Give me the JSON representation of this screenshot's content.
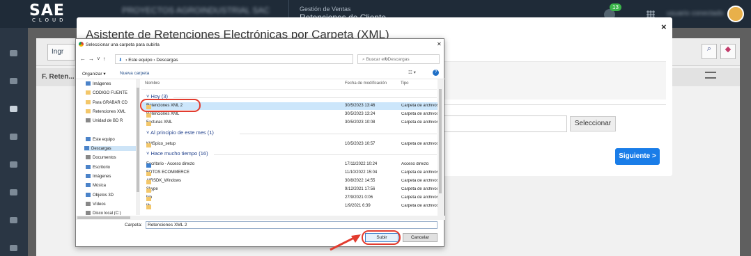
{
  "topbar": {
    "logo": "SAE",
    "logo_sub": "CLOUD",
    "company_blurred": "PROYECTOS AGROINDUSTRIAL SAC",
    "module_caption": "Gestión de Ventas",
    "module_title": "Retenciones de Cliente",
    "notifications": "13",
    "user_blurred": "usuario conectado"
  },
  "background": {
    "button_label": "Ingr",
    "section_title": "F. Reten..."
  },
  "modal": {
    "title": "Asistente de Retenciones Electrónicas por Carpeta (XML)",
    "close": "×",
    "select_button": "Seleccionar",
    "next_button": "Siguiente >"
  },
  "dialog": {
    "title": "Seleccionar una carpeta para subirla",
    "close": "✕",
    "address": [
      "Este equipo",
      "Descargas"
    ],
    "search_placeholder": "Buscar en Descargas",
    "organize": "Organizar ▾",
    "new_folder": "Nueva carpeta",
    "left_tree": [
      {
        "label": "Imágenes",
        "icon": "images-icon",
        "selected": false
      },
      {
        "label": "CODIGO FUENTE",
        "icon": "folder-icon",
        "selected": false
      },
      {
        "label": "Para GRABAR CD",
        "icon": "folder-icon",
        "selected": false
      },
      {
        "label": "Retenciones XML",
        "icon": "folder-icon",
        "selected": false
      },
      {
        "label": "Unidad de BD R",
        "icon": "drive-icon",
        "selected": false
      },
      {
        "label": "",
        "icon": "",
        "selected": false
      },
      {
        "label": "Este equipo",
        "icon": "computer-icon",
        "selected": false
      },
      {
        "label": "Descargas",
        "icon": "downloads-icon",
        "selected": true
      },
      {
        "label": "Documentos",
        "icon": "documents-icon",
        "selected": false
      },
      {
        "label": "Escritorio",
        "icon": "desktop-icon",
        "selected": false
      },
      {
        "label": "Imágenes",
        "icon": "images-icon",
        "selected": false
      },
      {
        "label": "Música",
        "icon": "music-icon",
        "selected": false
      },
      {
        "label": "Objetos 3D",
        "icon": "cube-icon",
        "selected": false
      },
      {
        "label": "Vídeos",
        "icon": "video-icon",
        "selected": false
      },
      {
        "label": "Disco local (C:)",
        "icon": "drive-icon",
        "selected": false
      }
    ],
    "columns": [
      "Nombre",
      "Fecha de modificación",
      "Tipo"
    ],
    "groups": [
      {
        "label": "Hoy (3)"
      },
      {
        "label": "Al principio de este mes (1)"
      },
      {
        "label": "Hace mucho tiempo (16)"
      }
    ],
    "rows": [
      {
        "name": "Retenciones XML 2",
        "date": "30/5/2023 13:46",
        "type": "Carpeta de archivos",
        "selected": true,
        "icon": "folder-icon"
      },
      {
        "name": "Retenciones XML",
        "date": "30/5/2023 13:24",
        "type": "Carpeta de archivos",
        "selected": false,
        "icon": "folder-icon"
      },
      {
        "name": "Facturas XML",
        "date": "30/5/2023 10:08",
        "type": "Carpeta de archivos",
        "selected": false,
        "icon": "folder-icon"
      },
      {
        "name": "KMSpico_setup",
        "date": "10/5/2023 10:57",
        "type": "Carpeta de archivos",
        "selected": false,
        "icon": "folder-icon"
      },
      {
        "name": "Escritorio - Acceso directo",
        "date": "17/11/2022 10:24",
        "type": "Acceso directo",
        "selected": false,
        "icon": "shortcut-icon"
      },
      {
        "name": "FOTOS ECOMMERCE",
        "date": "11/10/2022 15:04",
        "type": "Carpeta de archivos",
        "selected": false,
        "icon": "folder-icon"
      },
      {
        "name": "AIRSDK_Windows",
        "date": "30/8/2022 14:55",
        "type": "Carpeta de archivos",
        "selected": false,
        "icon": "folder-icon"
      },
      {
        "name": "Skype",
        "date": "9/12/2021 17:56",
        "type": "Carpeta de archivos",
        "selected": false,
        "icon": "folder-icon"
      },
      {
        "name": "bin",
        "date": "27/9/2021 0:06",
        "type": "Carpeta de archivos",
        "selected": false,
        "icon": "folder-icon"
      },
      {
        "name": "lib",
        "date": "1/9/2021 6:39",
        "type": "Carpeta de archivos",
        "selected": false,
        "icon": "folder-icon"
      }
    ],
    "folder_label": "Carpeta:",
    "folder_value": "Retenciones XML 2",
    "upload_button": "Subir",
    "cancel_button": "Cancelar"
  }
}
